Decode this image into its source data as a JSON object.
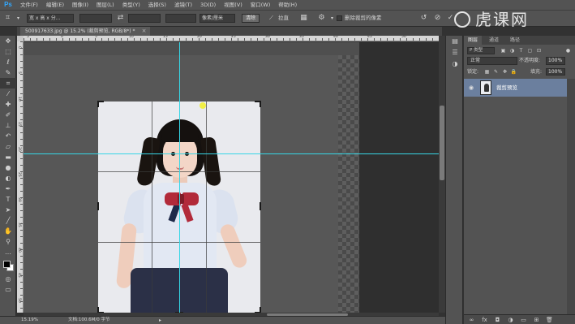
{
  "app": {
    "logo": "Ps"
  },
  "menu": [
    "文件(F)",
    "编辑(E)",
    "图像(I)",
    "图层(L)",
    "类型(Y)",
    "选择(S)",
    "滤镜(T)",
    "3D(D)",
    "视图(V)",
    "窗口(W)",
    "帮助(H)"
  ],
  "options": {
    "preset": "宽 x 高 x 分...",
    "width_value": "",
    "height_value": "",
    "resolution_unit": "像素/厘米",
    "clear_button": "清除",
    "straighten_label": "拉直",
    "delete_cropped_label": "删除裁剪的像素",
    "delete_cropped_checked": false
  },
  "watermark": {
    "text": "虎课网"
  },
  "document": {
    "tab_title": "500917633.jpg @ 15.2% (裁剪预览, RGB/8*) *",
    "zoom": "15.19%",
    "doc_info": "文档:100.6M/0 字节"
  },
  "ruler": {
    "top_labels": [
      "5",
      "0",
      "5",
      "10",
      "15",
      "20",
      "25",
      "30",
      "35",
      "40",
      "45",
      "50"
    ],
    "left_labels": [
      "0",
      "5",
      "10",
      "15",
      "20",
      "25",
      "30",
      "35",
      "40",
      "45",
      "50"
    ]
  },
  "layers_panel": {
    "tabs": [
      "图层",
      "通道",
      "路径"
    ],
    "filter_label": "P 类型",
    "blend_mode": "正常",
    "opacity_label": "不透明度:",
    "opacity_value": "100%",
    "lock_label": "锁定:",
    "fill_label": "填充:",
    "fill_value": "100%",
    "layer_name": "裁剪预览"
  },
  "colors": {
    "guide": "#36d6e6",
    "layer_selected": "#6b7f9e",
    "foreground": "#000000",
    "background": "#ffffff"
  },
  "icons": {
    "toolbar": [
      "move-icon",
      "marquee-icon",
      "lasso-icon",
      "quick-select-icon",
      "crop-icon",
      "eyedropper-icon",
      "spot-heal-icon",
      "brush-icon",
      "clone-stamp-icon",
      "history-brush-icon",
      "eraser-icon",
      "gradient-icon",
      "blur-icon",
      "dodge-icon",
      "pen-icon",
      "type-icon",
      "path-select-icon",
      "shape-icon",
      "hand-icon",
      "zoom-icon"
    ]
  }
}
